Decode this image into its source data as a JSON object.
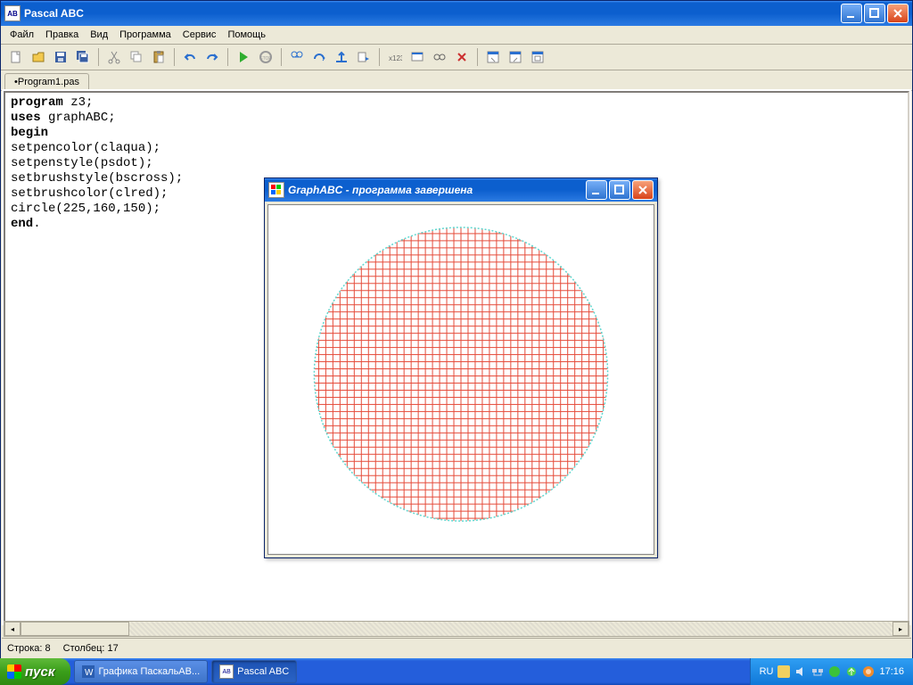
{
  "mainWindow": {
    "title": "Pascal ABC",
    "menus": [
      "Файл",
      "Правка",
      "Вид",
      "Программа",
      "Сервис",
      "Помощь"
    ],
    "tab": "•Program1.pas",
    "code": {
      "l1k": "program",
      "l1r": " z3;",
      "l2k": "uses",
      "l2r": " graphABC;",
      "l3": "begin",
      "l4": "setpencolor(claqua);",
      "l5": "setpenstyle(psdot);",
      "l6": "setbrushstyle(bscross);",
      "l7": "setbrushcolor(clred);",
      "l8": "circle(225,160,150);",
      "l9k": "end",
      "l9r": "."
    },
    "status": {
      "line": "Строка: 8",
      "col": "Столбец: 17"
    }
  },
  "childWindow": {
    "title": "GraphABC - программа завершена"
  },
  "taskbar": {
    "start": "пуск",
    "btn1": "Графика ПаскальАВ...",
    "btn2": "Pascal ABC",
    "lang": "RU",
    "time": "17:16"
  },
  "colors": {
    "accent": "#0c5fce",
    "red": "#e54b3a",
    "aqua": "#5fd8d0"
  }
}
